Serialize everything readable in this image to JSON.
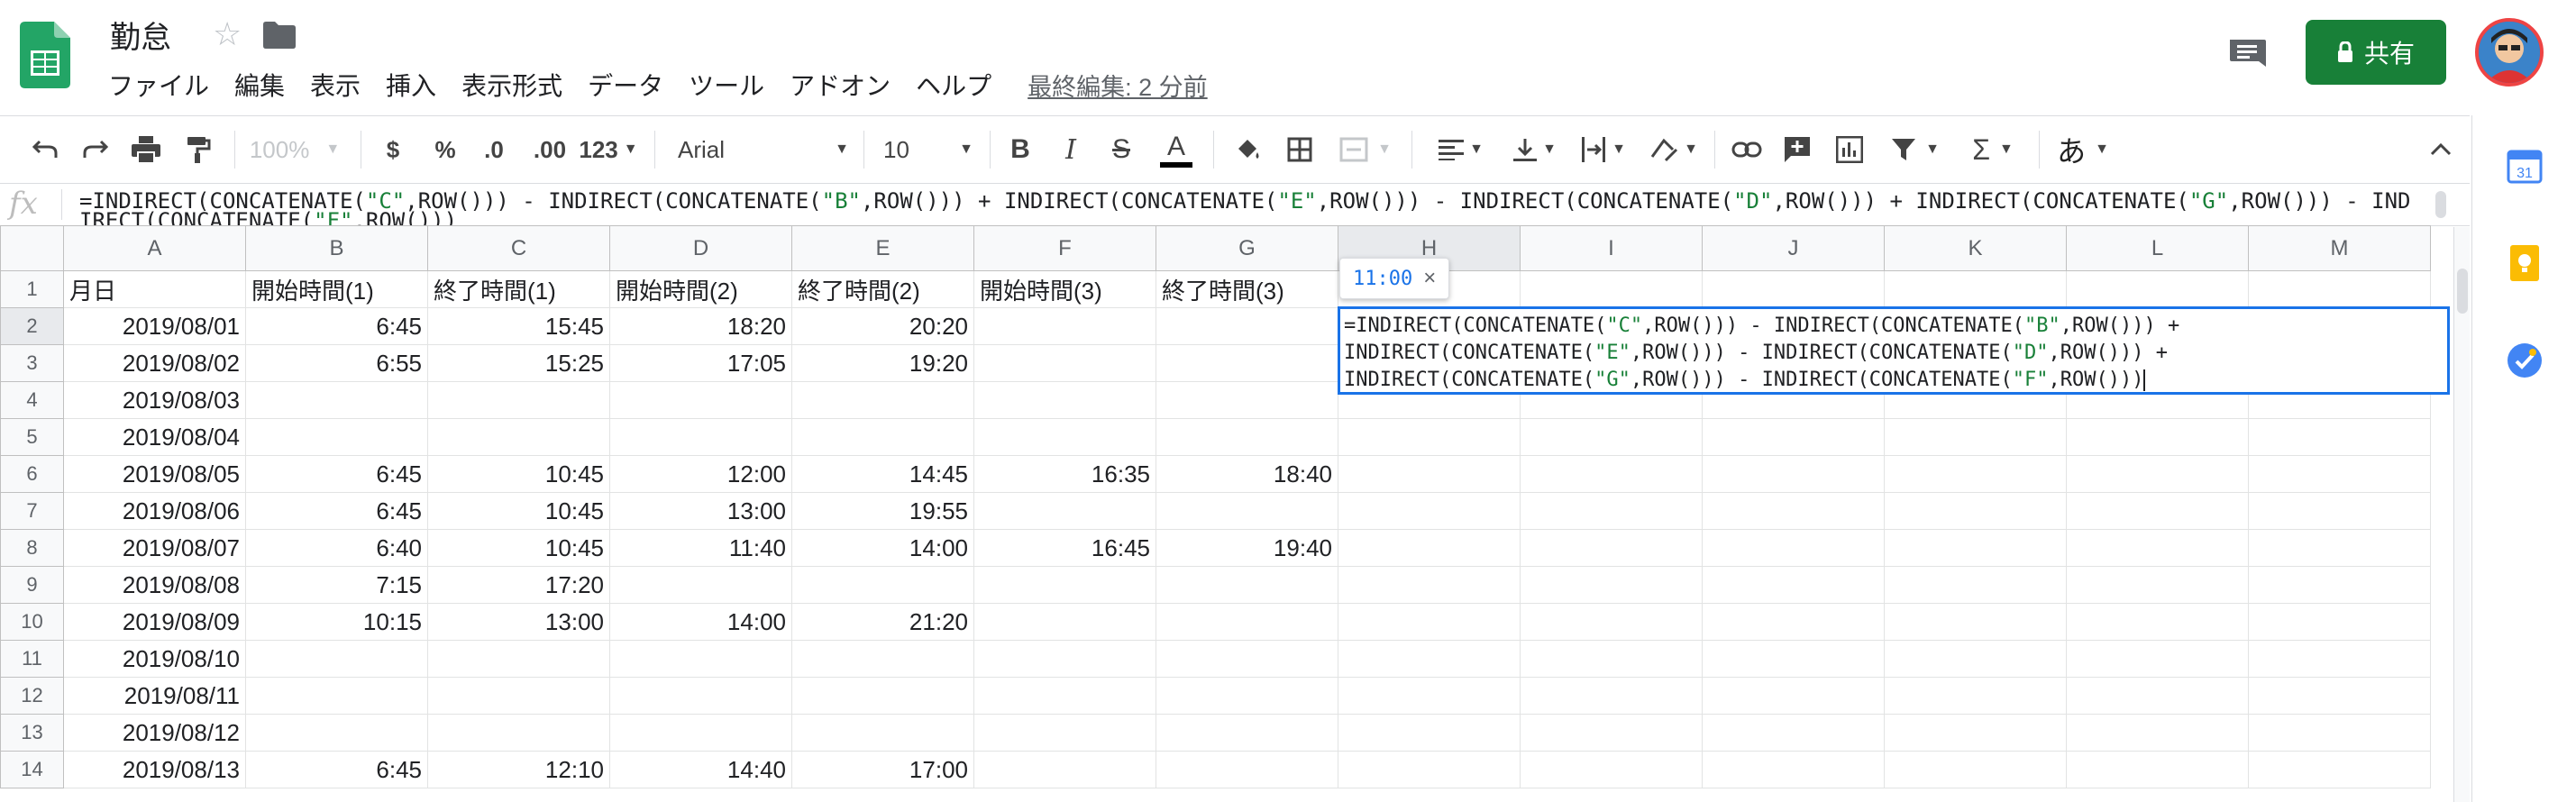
{
  "app": {
    "doc_title": "勤怠",
    "menu": [
      "ファイル",
      "編集",
      "表示",
      "挿入",
      "表示形式",
      "データ",
      "ツール",
      "アドオン",
      "ヘルプ"
    ],
    "last_edit": "最終編集: 2 分前",
    "share_label": "共有",
    "brand_color": "#188038",
    "accent_color": "#1a73e8"
  },
  "toolbar": {
    "zoom": "100%",
    "currency": "$",
    "percent": "%",
    "dec_decrease": ".0",
    "dec_increase": ".00",
    "more_formats": "123",
    "font": "Arial",
    "font_size": "10",
    "input_tool": "あ"
  },
  "formula_bar": {
    "fx": "fx"
  },
  "sheet": {
    "columns": [
      "A",
      "B",
      "C",
      "D",
      "E",
      "F",
      "G",
      "H",
      "I",
      "J",
      "K",
      "L",
      "M"
    ],
    "rows": [
      {
        "n": "1",
        "cells": [
          "月日",
          "開始時間(1)",
          "終了時間(1)",
          "開始時間(2)",
          "終了時間(2)",
          "開始時間(3)",
          "終了時間(3)",
          "",
          "",
          "",
          "",
          "",
          ""
        ]
      },
      {
        "n": "2",
        "cells": [
          "2019/08/01",
          "6:45",
          "15:45",
          "18:20",
          "20:20",
          "",
          "",
          "",
          "",
          "",
          "",
          "",
          ""
        ]
      },
      {
        "n": "3",
        "cells": [
          "2019/08/02",
          "6:55",
          "15:25",
          "17:05",
          "19:20",
          "",
          "",
          "",
          "",
          "",
          "",
          "",
          ""
        ]
      },
      {
        "n": "4",
        "cells": [
          "2019/08/03",
          "",
          "",
          "",
          "",
          "",
          "",
          "",
          "",
          "",
          "",
          "",
          ""
        ]
      },
      {
        "n": "5",
        "cells": [
          "2019/08/04",
          "",
          "",
          "",
          "",
          "",
          "",
          "",
          "",
          "",
          "",
          "",
          ""
        ]
      },
      {
        "n": "6",
        "cells": [
          "2019/08/05",
          "6:45",
          "10:45",
          "12:00",
          "14:45",
          "16:35",
          "18:40",
          "",
          "",
          "",
          "",
          "",
          ""
        ]
      },
      {
        "n": "7",
        "cells": [
          "2019/08/06",
          "6:45",
          "10:45",
          "13:00",
          "19:55",
          "",
          "",
          "",
          "",
          "",
          "",
          "",
          ""
        ]
      },
      {
        "n": "8",
        "cells": [
          "2019/08/07",
          "6:40",
          "10:45",
          "11:40",
          "14:00",
          "16:45",
          "19:40",
          "",
          "",
          "",
          "",
          "",
          ""
        ]
      },
      {
        "n": "9",
        "cells": [
          "2019/08/08",
          "7:15",
          "17:20",
          "",
          "",
          "",
          "",
          "",
          "",
          "",
          "",
          "",
          ""
        ]
      },
      {
        "n": "10",
        "cells": [
          "2019/08/09",
          "10:15",
          "13:00",
          "14:00",
          "21:20",
          "",
          "",
          "",
          "",
          "",
          "",
          "",
          ""
        ]
      },
      {
        "n": "11",
        "cells": [
          "2019/08/10",
          "",
          "",
          "",
          "",
          "",
          "",
          "",
          "",
          "",
          "",
          "",
          ""
        ]
      },
      {
        "n": "12",
        "cells": [
          "2019/08/11",
          "",
          "",
          "",
          "",
          "",
          "",
          "",
          "",
          "",
          "",
          "",
          ""
        ]
      },
      {
        "n": "13",
        "cells": [
          "2019/08/12",
          "",
          "",
          "",
          "",
          "",
          "",
          "",
          "",
          "",
          "",
          "",
          ""
        ]
      },
      {
        "n": "14",
        "cells": [
          "2019/08/13",
          "6:45",
          "12:10",
          "14:40",
          "17:00",
          "",
          "",
          "",
          "",
          "",
          "",
          "",
          ""
        ]
      }
    ]
  },
  "editor": {
    "tooltip_value": "11:00",
    "tooltip_close": "×",
    "selected_column": "H",
    "selected_row": "2",
    "formula_parts": {
      "p_eq": "=INDIRECT(CONCATENATE(",
      "p_mid": ",ROW())) - INDIRECT(CONCATENATE(",
      "p_plus_end": ",ROW())) + ",
      "p_indirect": "INDIRECT(CONCATENATE(",
      "p_end": ",ROW()))",
      "c": "\"C\"",
      "b": "\"B\"",
      "e": "\"E\"",
      "d": "\"D\"",
      "g": "\"G\"",
      "f": "\"F\""
    }
  },
  "side_panel": {
    "calendar_day": "31"
  }
}
